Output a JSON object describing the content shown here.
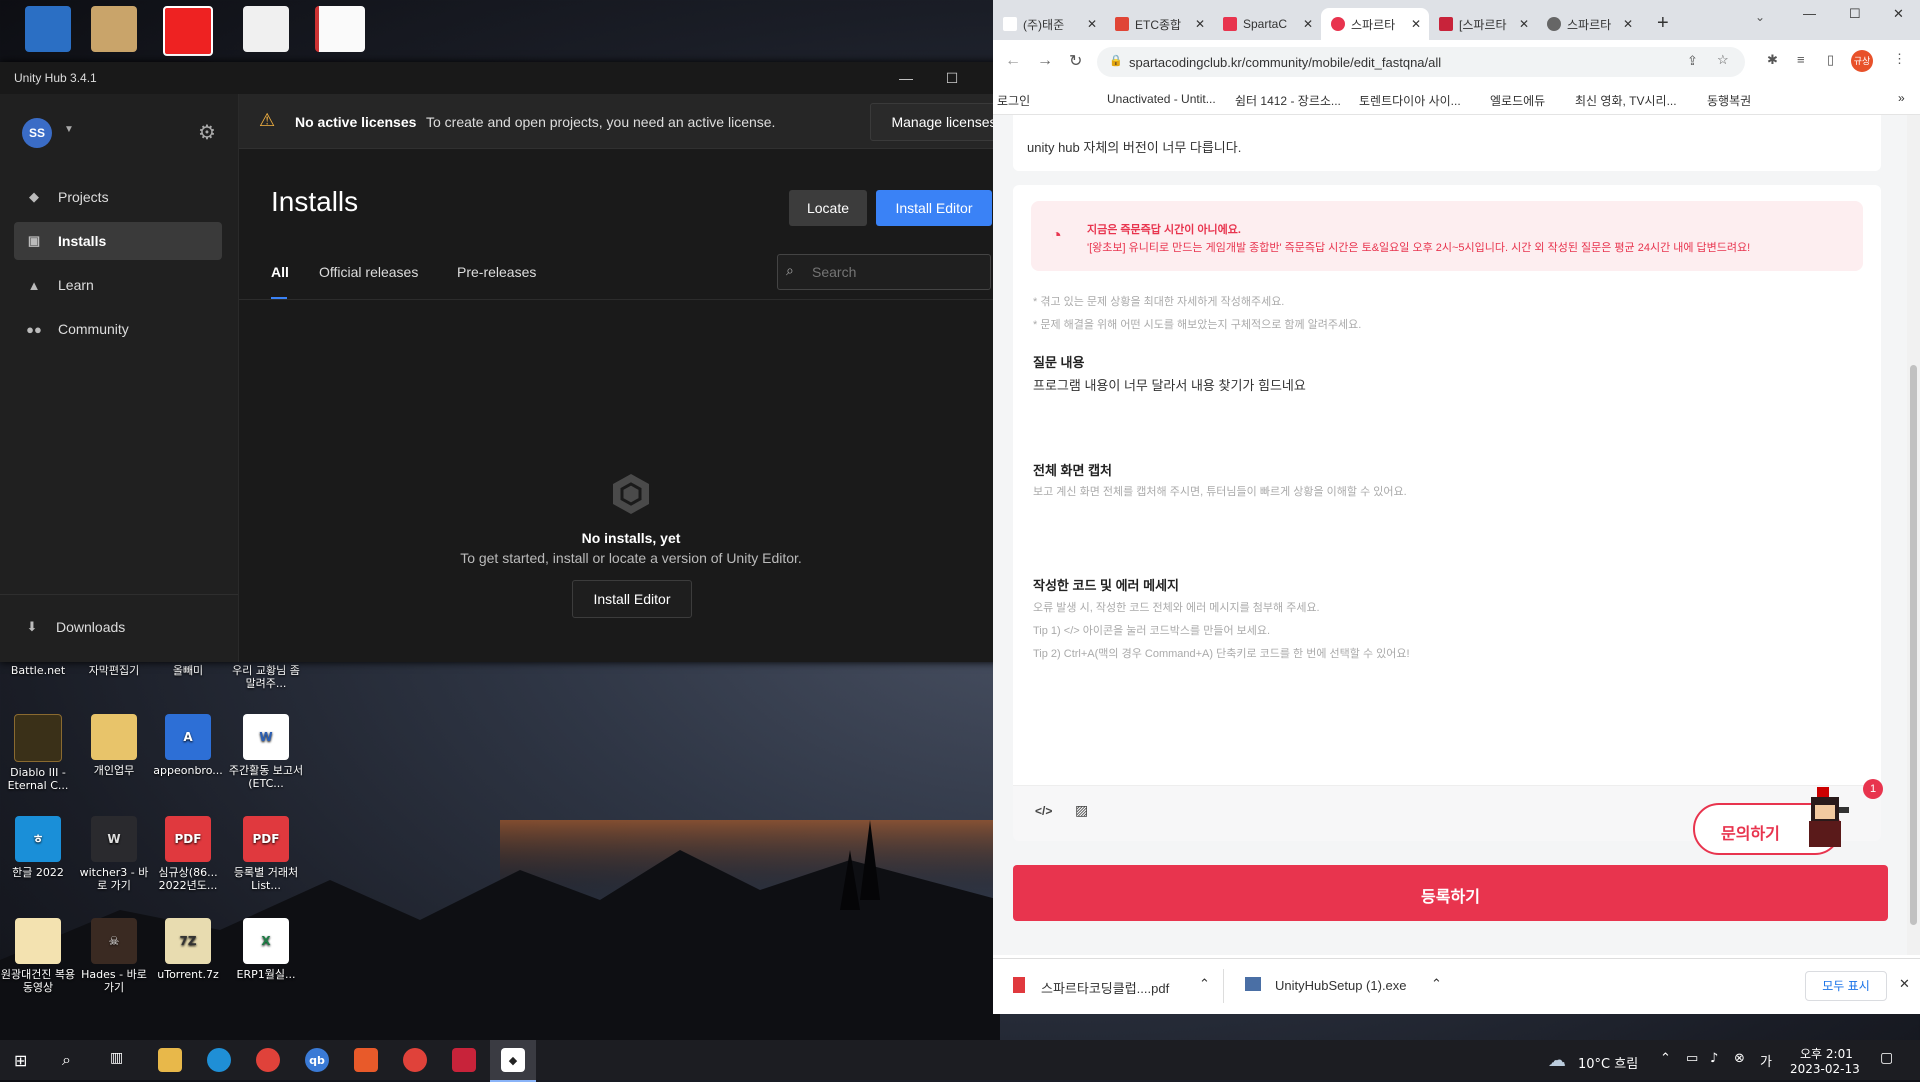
{
  "desktop": {
    "top_icons": [],
    "labels_row1": [
      "Battle.net",
      "자막편집기",
      "올빼미",
      "우리 교황님 좀 말려주..."
    ],
    "icons": [
      {
        "label": "Diablo III - Eternal C...",
        "icon": "diablo-icon"
      },
      {
        "label": "개인업무",
        "icon": "folder-icon"
      },
      {
        "label": "appeonbro...",
        "icon": "appeon-icon"
      },
      {
        "label": "주간활동 보고서(ETC...",
        "icon": "word-doc-icon"
      },
      {
        "label": "한글 2022",
        "icon": "hangul-icon"
      },
      {
        "label": "witcher3 - 바로 가기",
        "icon": "witcher-icon"
      },
      {
        "label": "심규상(86... 2022년도...",
        "icon": "pdf-icon"
      },
      {
        "label": "등록별 거래처 List...",
        "icon": "pdf-icon"
      },
      {
        "label": "원광대건진 복용동영상",
        "icon": "folder-icon"
      },
      {
        "label": "Hades - 바로 가기",
        "icon": "hades-icon"
      },
      {
        "label": "uTorrent.7z",
        "icon": "7z-icon"
      },
      {
        "label": "ERP1월실...",
        "icon": "excel-icon"
      }
    ]
  },
  "hub": {
    "title": "Unity Hub 3.4.1",
    "avatar": "SS",
    "nav": [
      "Projects",
      "Installs",
      "Learn",
      "Community"
    ],
    "downloads": "Downloads",
    "banner_bold": "No active licenses",
    "banner_text": "To create and open projects, you need an active license.",
    "manage_licenses": "Manage licenses",
    "heading": "Installs",
    "locate": "Locate",
    "install_editor": "Install Editor",
    "tabs": [
      "All",
      "Official releases",
      "Pre-releases"
    ],
    "search_placeholder": "Search",
    "empty_title": "No installs, yet",
    "empty_sub": "To get started, install or locate a version of Unity Editor.",
    "empty_button": "Install Editor"
  },
  "browser": {
    "tabs": [
      "(주)태준",
      "ETC종합",
      "SpartaC",
      "스파르타",
      "[스파르타",
      "스파르타"
    ],
    "url": "spartacodingclub.kr/community/mobile/edit_fastqna/all",
    "bookmarks": [
      "로그인",
      "Unactivated - Untit...",
      "쉼터 1412 - 장르소...",
      "토렌트다이아 사이...",
      "엘로드에듀",
      "최신 영화, TV시리...",
      "동행복권"
    ],
    "profile_badge": "규상",
    "top_text": "unity hub 자체의 버전이 너무 다릅니다.",
    "notice_title": "지금은 즉문즉답 시간이 아니에요.",
    "notice_body": "'[왕초보] 유니티로 만드는 게임개발 종합반' 즉문즉답 시간은 토&일요일 오후 2시~5시입니다. 시간 외 작성된 질문은 평균 24시간 내에 답변드려요!",
    "hints": [
      "* 겪고 있는 문제 상황을 최대한 자세하게 작성해주세요.",
      "* 문제 해결을 위해 어떤 시도를 해보았는지 구체적으로 함께 알려주세요."
    ],
    "q_label": "질문 내용",
    "q_text": "프로그램 내용이 너무 달라서 내용 찾기가 힘드네요",
    "cap_label": "전체 화면 캡처",
    "cap_hint": "보고 계신 화면 전체를 캡처해 주시면, 튜터님들이 빠르게 상황을 이해할 수 있어요.",
    "code_label": "작성한 코드 및 에러 메세지",
    "code_hints": [
      "오류 발생 시, 작성한 코드 전체와 에러 메시지를 첨부해 주세요.",
      "Tip 1) </> 아이콘을 눌러 코드박스를 만들어 보세요.",
      "Tip 2) Ctrl+A(맥의 경우 Command+A) 단축키로 코드를 한 번에 선택할 수 있어요!"
    ],
    "inquiry_button": "문의하기",
    "inquiry_badge": "1",
    "submit_button": "등록하기",
    "downloads": [
      "스파르타코딩클럽....pdf",
      "UnityHubSetup (1).exe"
    ],
    "show_all": "모두 표시"
  },
  "taskbar": {
    "weather": "10°C  흐림",
    "time": "오후 2:01",
    "date": "2023-02-13"
  },
  "colors": {
    "accent_blue": "#3a82f6",
    "sparta_red": "#e8344e",
    "warn_yellow": "#f5b342"
  }
}
